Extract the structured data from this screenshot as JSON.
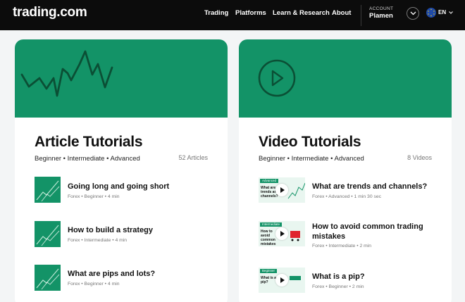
{
  "header": {
    "logo": "trading.com",
    "nav": [
      "Trading",
      "Platforms",
      "Learn & Research",
      "About"
    ],
    "account_label": "ACCOUNT",
    "account_name": "Plamen",
    "lang": "EN"
  },
  "article_card": {
    "title": "Article Tutorials",
    "levels": "Beginner • Intermediate • Advanced",
    "count": "52 Articles",
    "items": [
      {
        "title": "Going long and going short",
        "meta": "Forex  •  Beginner  •  4 min"
      },
      {
        "title": "How to build a strategy",
        "meta": "Forex  •  Intermediate  •  4 min"
      },
      {
        "title": "What are pips and lots?",
        "meta": "Forex  •  Beginner  •  4 min"
      }
    ]
  },
  "video_card": {
    "title": "Video Tutorials",
    "levels": "Beginner • Intermediate • Advanced",
    "count": "8 Videos",
    "items": [
      {
        "title": "What are trends and channels?",
        "meta": "Forex  •  Advanced  •  1 min 30 sec",
        "badge": "Advanced",
        "thumb_text": "What are trends and channels?"
      },
      {
        "title": "How to avoid common trading mistakes",
        "meta": "Forex  •  Intermediate  •  2 min",
        "badge": "Intermediate",
        "thumb_text": "How to avoid common mistakes"
      },
      {
        "title": "What is a pip?",
        "meta": "Forex  •  Beginner  •  2 min",
        "badge": "Beginner",
        "thumb_text": "What is a pip?"
      }
    ]
  },
  "colors": {
    "brand": "#139367",
    "header": "#0c0c0c"
  }
}
